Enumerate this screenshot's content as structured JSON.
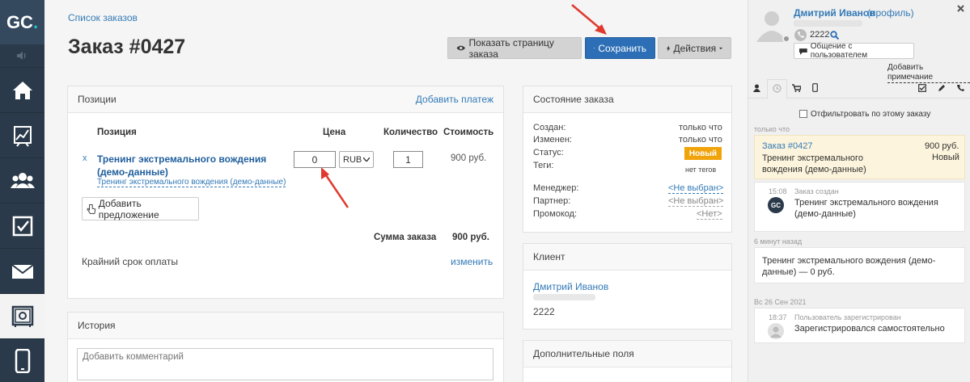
{
  "logo": {
    "text": "GC",
    "dot": "."
  },
  "sidebar": {
    "items": [
      {
        "name": "home"
      },
      {
        "name": "chart"
      },
      {
        "name": "users"
      },
      {
        "name": "tasks"
      },
      {
        "name": "mail"
      },
      {
        "name": "safe"
      },
      {
        "name": "mobile"
      }
    ]
  },
  "breadcrumb": "Список заказов",
  "page_title": "Заказ #0427",
  "toolbar": {
    "show_page": "Показать страницу заказа",
    "save": "Сохранить",
    "actions": "Действия"
  },
  "positions": {
    "title": "Позиции",
    "add_payment": "Добавить платеж",
    "headers": {
      "position": "Позиция",
      "price": "Цена",
      "qty": "Количество",
      "cost": "Стоимость"
    },
    "row": {
      "remove": "x",
      "name": "Тренинг экстремального вождения (демо-данные)",
      "sub": "Тренинг экстремального вождения (демо-данные)",
      "price": "0",
      "currency": "RUB",
      "qty": "1",
      "cost": "900 руб."
    },
    "add_offer": "Добавить предложение",
    "total_label": "Сумма заказа",
    "total_value": "900 руб.",
    "deadline_label": "Крайний срок оплаты",
    "deadline_change": "изменить"
  },
  "history": {
    "title": "История",
    "placeholder": "Добавить комментарий"
  },
  "order_state": {
    "title": "Состояние заказа",
    "created_label": "Создан:",
    "created_value": "только что",
    "changed_label": "Изменен:",
    "changed_value": "только что",
    "status_label": "Статус:",
    "status_value": "Новый",
    "tags_label": "Теги:",
    "tags_value": "нет тегов",
    "manager_label": "Менеджер:",
    "manager_value": "<Не выбран>",
    "partner_label": "Партнер:",
    "partner_value": "<Не выбран>",
    "promo_label": "Промокод:",
    "promo_value": "<Нет>"
  },
  "client": {
    "title": "Клиент",
    "name": "Дмитрий Иванов",
    "phone": "2222"
  },
  "extra": {
    "title": "Дополнительные поля"
  },
  "right": {
    "user_name": "Дмитрий Иванов",
    "profile_link": "(профиль)",
    "phone": "2222",
    "chat_button": "Общение с пользователем",
    "add_note": "Добавить примечание",
    "filter_label": "Отфильтровать по этому заказу",
    "sec_now": "только что",
    "order_card": {
      "title": "Заказ #0427",
      "price": "900 руб.",
      "desc": "Тренинг экстремального вождения (демо-данные)",
      "status": "Новый"
    },
    "created_card": {
      "time": "15:08",
      "title": "Заказ создан",
      "desc": "Тренинг экстремального вождения (демо-данные)"
    },
    "sec_6min": "6 минут назад",
    "item_card": "Тренинг экстремального вождения (демо-данные) — 0 руб.",
    "sec_date": "Вс 26 Сен 2021",
    "reg_card": {
      "time": "18:37",
      "title": "Пользователь зарегистрирован",
      "desc": "Зарегистрировался самостоятельно"
    }
  },
  "colors": {
    "accent": "#2c6fb6",
    "status": "#f0a30a",
    "sidebar": "#2b3a4a",
    "arrow": "#e03a2f"
  }
}
